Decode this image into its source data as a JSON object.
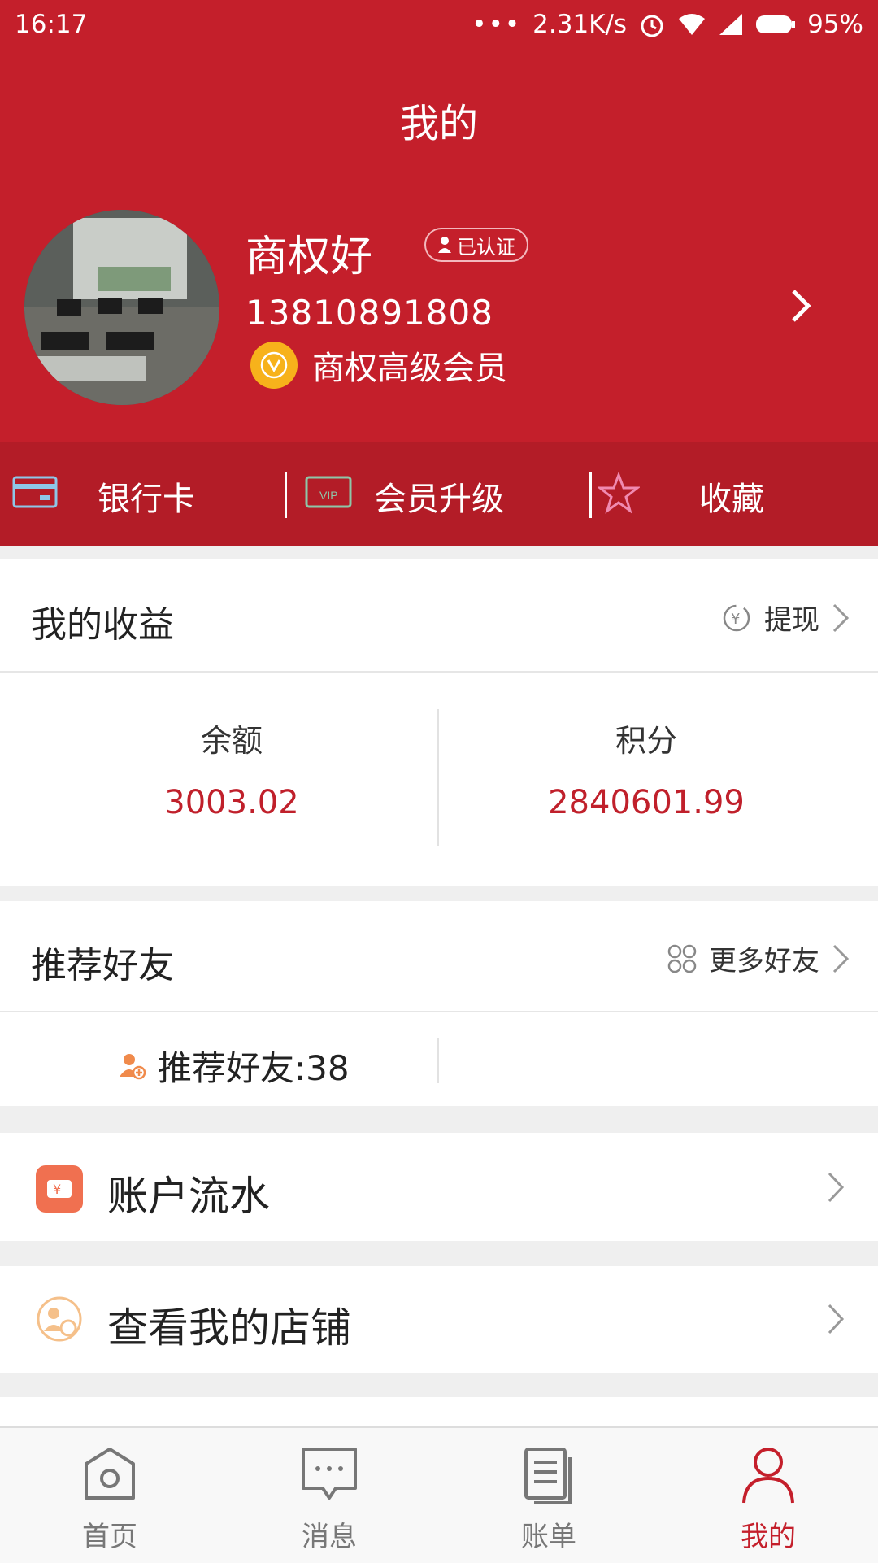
{
  "status": {
    "time": "16:17",
    "speed": "2.31K/s",
    "battery": "95%"
  },
  "header": {
    "title": "我的"
  },
  "profile": {
    "name": "商权好",
    "verified": "已认证",
    "phone": "13810891808",
    "level": "商权高级会员"
  },
  "shortcuts": [
    {
      "label": "银行卡",
      "icon": "bank-card-icon"
    },
    {
      "label": "会员升级",
      "icon": "vip-card-icon"
    },
    {
      "label": "收藏",
      "icon": "star-icon"
    }
  ],
  "earnings": {
    "title": "我的收益",
    "action": "提现",
    "balance_label": "余额",
    "balance": "3003.02",
    "points_label": "积分",
    "points": "2840601.99"
  },
  "friends": {
    "title": "推荐好友",
    "action": "更多好友",
    "count_text": "推荐好友:38"
  },
  "rows": [
    {
      "label": "账户流水",
      "icon": "account-flow-icon"
    },
    {
      "label": "查看我的店铺",
      "icon": "store-icon"
    }
  ],
  "tabs": [
    {
      "label": "首页",
      "icon": "home-icon"
    },
    {
      "label": "消息",
      "icon": "message-icon"
    },
    {
      "label": "账单",
      "icon": "bill-icon"
    },
    {
      "label": "我的",
      "icon": "profile-icon",
      "active": true
    }
  ],
  "colors": {
    "brand_red": "#c41f2b",
    "shortcut_bar": "#b31c27",
    "value_red": "#c0202b",
    "coin": "#f7b21b"
  }
}
